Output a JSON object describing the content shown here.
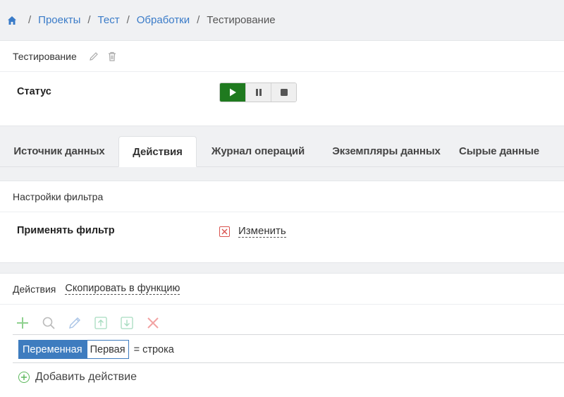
{
  "breadcrumb": {
    "items": [
      "Проекты",
      "Тест",
      "Обработки"
    ],
    "current": "Тестирование"
  },
  "status_card": {
    "title": "Тестирование",
    "status_label": "Статус"
  },
  "tabs": [
    {
      "label": "Источник данных",
      "active": false
    },
    {
      "label": "Действия",
      "active": true
    },
    {
      "label": "Журнал операций",
      "active": false
    },
    {
      "label": "Экземпляры данных",
      "active": false
    },
    {
      "label": "Сырые данные",
      "active": false
    }
  ],
  "filter_card": {
    "title": "Настройки фильтра",
    "apply_label": "Применять фильтр",
    "change_link": "Изменить"
  },
  "actions_card": {
    "title": "Действия",
    "copy_link": "Скопировать в функцию",
    "row": {
      "var_tag": "Переменная",
      "var_name": "Первая",
      "expression": "= строка"
    },
    "add_action": "Добавить действие"
  },
  "colors": {
    "link": "#3a7bc8",
    "play_green": "#1f7a1f",
    "tag_blue": "#3e7cbf",
    "danger": "#d9534f",
    "success": "#5cb85c"
  }
}
